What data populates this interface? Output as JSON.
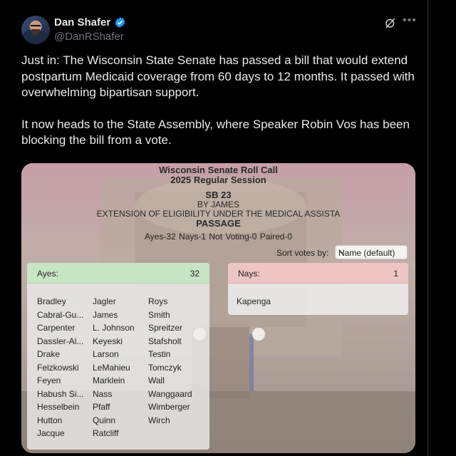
{
  "author": {
    "name": "Dan Shafer",
    "handle": "@DanRShafer",
    "verified": true
  },
  "icons": {
    "verified": "verified-badge-icon",
    "grok": "grok-icon",
    "more": "more-icon"
  },
  "tweet": {
    "paragraph1": "Just in: The Wisconsin State Senate has passed a bill that would extend postpartum Medicaid coverage from 60 days to 12 months. It passed with overwhelming bipartisan support.",
    "paragraph2": "It now heads to the State Assembly, where Speaker Robin Vos has been blocking the bill from a vote."
  },
  "roll_call": {
    "title": "Wisconsin Senate Roll Call",
    "session": "2025 Regular Session",
    "bill": "SB 23",
    "author": "BY JAMES",
    "description": "EXTENSION OF ELIGIBILITY UNDER THE MEDICAL ASSISTA",
    "action": "PASSAGE",
    "tally": "Ayes-32  Nays-1  Not Voting-0  Paired-0",
    "sort_label": "Sort votes by:",
    "sort_value": "Name (default)",
    "ayes_label": "Ayes:",
    "ayes_count": "32",
    "nays_label": "Nays:",
    "nays_count": "1",
    "ayes_col1": [
      "Bradley",
      "Cabral-Gu...",
      "Carpenter",
      "Dassler-Al...",
      "Drake",
      "Felzkowski",
      "Feyen",
      "Habush Si...",
      "Hesselbein",
      "Hutton",
      "Jacque"
    ],
    "ayes_col2": [
      "Jagler",
      "James",
      "L. Johnson",
      "Keyeski",
      "Larson",
      "LeMahieu",
      "Marklein",
      "Nass",
      "Pfaff",
      "Quinn",
      "Ratcliff"
    ],
    "ayes_col3": [
      "Roys",
      "Smith",
      "Spreitzer",
      "Stafsholt",
      "Testin",
      "Tomczyk",
      "Wall",
      "Wanggaard",
      "Wimberger",
      "Wirch"
    ],
    "nays": [
      "Kapenga"
    ]
  },
  "colors": {
    "background": "#000000",
    "ayes_header": "#c8e6c5",
    "nays_header": "#eec5c5",
    "verified": "#1d9bf0"
  }
}
